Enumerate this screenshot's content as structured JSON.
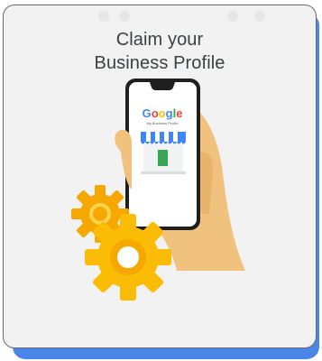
{
  "card": {
    "title_line1": "Claim your",
    "title_line2": "Business Profile"
  },
  "illustration": {
    "phone_logo_text": "Google",
    "phone_subtitle": "My Business Profile",
    "colors": {
      "google_blue": "#4285f4",
      "google_red": "#ea4335",
      "google_yellow": "#fbbc05",
      "google_green": "#34a853",
      "gear_orange": "#f6a800",
      "skin": "#f1c27d",
      "accent_shadow": "#4a86e8"
    }
  }
}
